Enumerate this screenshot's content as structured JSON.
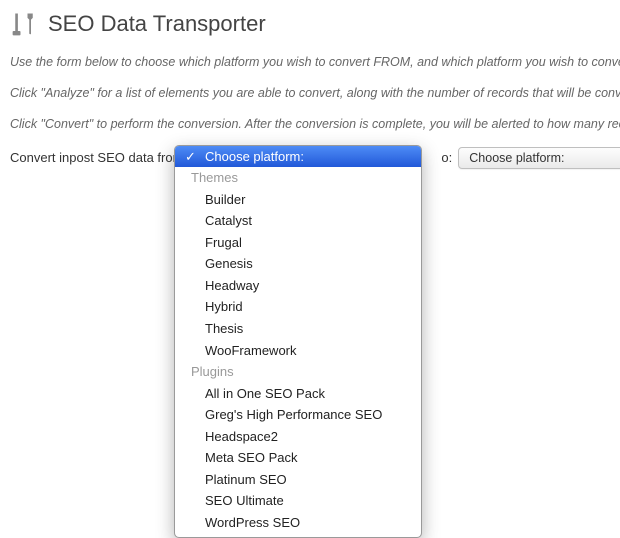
{
  "header": {
    "title": "SEO Data Transporter"
  },
  "intro": {
    "p1": "Use the form below to choose which platform you wish to convert FROM, and which platform you wish to convert",
    "p2": "Click \"Analyze\" for a list of elements you are able to convert, along with the number of records that will be conver­unchanged. Any compatible elements will be displayed for your review. Also, some records will be ignored if the",
    "p3": "Click \"Convert\" to perform the conversion. After the conversion is complete, you will be alerted to how many reco"
  },
  "form": {
    "prefix": "Convert inpost SEO data from",
    "to_label": "o:",
    "from_placeholder": "Choose platform:",
    "to_placeholder": "Choose platform:"
  },
  "dropdown": {
    "placeholder": "Choose platform:",
    "groups": {
      "themes": {
        "label": "Themes",
        "items": [
          "Builder",
          "Catalyst",
          "Frugal",
          "Genesis",
          "Headway",
          "Hybrid",
          "Thesis",
          "WooFramework"
        ]
      },
      "plugins": {
        "label": "Plugins",
        "items": [
          "All in One SEO Pack",
          "Greg's High Performance SEO",
          "Headspace2",
          "Meta SEO Pack",
          "Platinum SEO",
          "SEO Ultimate",
          "WordPress SEO"
        ]
      }
    }
  }
}
